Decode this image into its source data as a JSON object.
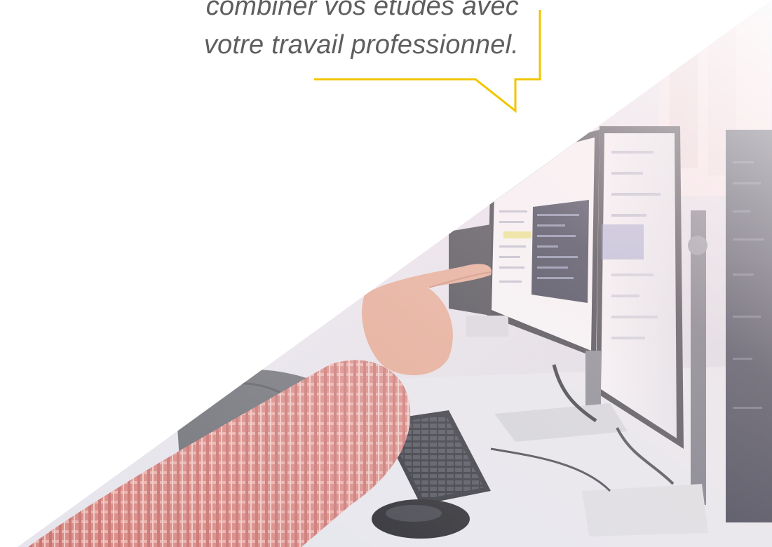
{
  "quote": {
    "lines": [
      "combiner vos études avec",
      "votre travail professionnel."
    ]
  },
  "colors": {
    "accent": "#f2c500",
    "quote_text": "#5e5e5e",
    "background": "#ffffff"
  },
  "photo": {
    "subject": "developer-at-computer-monitors"
  }
}
